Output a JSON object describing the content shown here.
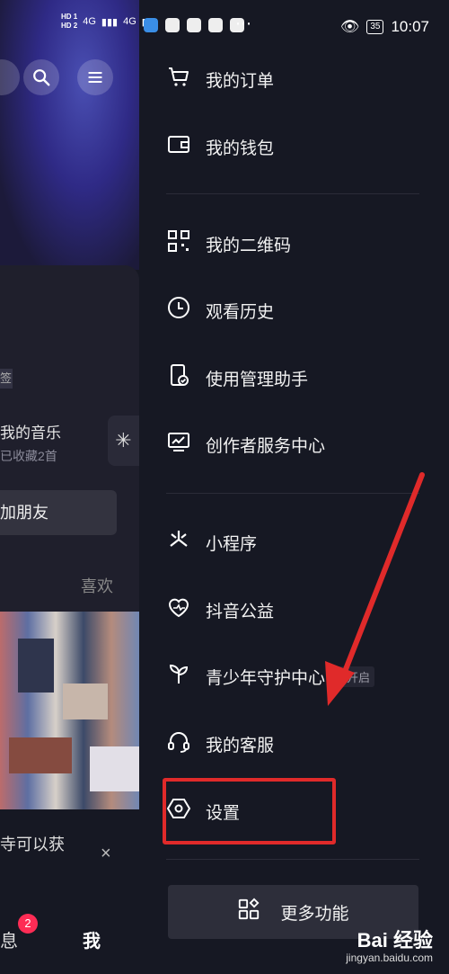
{
  "status_bar": {
    "network1": "4G",
    "network2": "4G",
    "hd1": "HD 1",
    "hd2": "HD 2",
    "battery": "35",
    "time": "10:07"
  },
  "background": {
    "tag_fragment": "签",
    "my_music": "我的音乐",
    "music_sub": "已收藏2首",
    "add_friend": "加朋友",
    "likes": "喜欢",
    "hint_fragment": "寺可以获",
    "close": "×",
    "message_fragment": "息",
    "message_badge": "2",
    "me_tab": "我"
  },
  "menu": {
    "group1": [
      {
        "icon": "cart-icon",
        "label": "我的订单"
      },
      {
        "icon": "wallet-icon",
        "label": "我的钱包"
      }
    ],
    "group2": [
      {
        "icon": "qrcode-icon",
        "label": "我的二维码"
      },
      {
        "icon": "clock-icon",
        "label": "观看历史"
      },
      {
        "icon": "phone-manager-icon",
        "label": "使用管理助手"
      },
      {
        "icon": "creator-chart-icon",
        "label": "创作者服务中心"
      }
    ],
    "group3": [
      {
        "icon": "miniprogram-icon",
        "label": "小程序"
      },
      {
        "icon": "heart-charity-icon",
        "label": "抖音公益"
      },
      {
        "icon": "sprout-icon",
        "label": "青少年守护中心",
        "badge": "已开启"
      },
      {
        "icon": "headset-icon",
        "label": "我的客服"
      },
      {
        "icon": "settings-hexagon-icon",
        "label": "设置"
      }
    ],
    "more_button": "更多功能"
  },
  "watermark": {
    "brand": "Bai 经验",
    "site": "jingyan.baidu.com"
  },
  "colors": {
    "background": "#161823",
    "annotation_red": "#e02a2a",
    "badge_red": "#fe2c55"
  }
}
